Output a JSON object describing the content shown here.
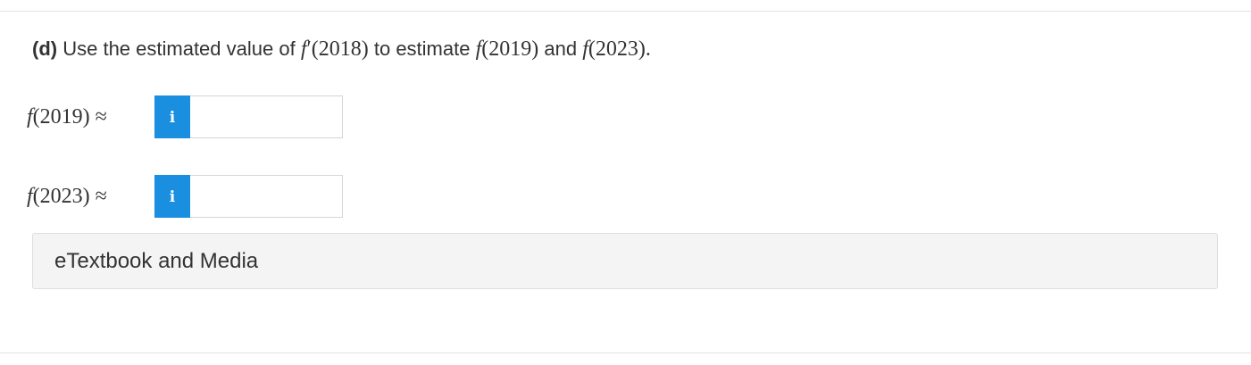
{
  "question": {
    "part_label": "(d)",
    "text_before": "Use the estimated value of",
    "derivative_expr": {
      "fn": "f",
      "prime": "′",
      "arg": "(2018)"
    },
    "text_middle": "to estimate",
    "expr1": {
      "fn": "f",
      "arg": "(2019)"
    },
    "text_and": "and",
    "expr2": {
      "fn": "f",
      "arg": "(2023)"
    },
    "end_punct": "."
  },
  "answers": [
    {
      "label_fn": "f",
      "label_arg": "(2019)",
      "approx_symbol": "≈",
      "info_icon": "i",
      "value": ""
    },
    {
      "label_fn": "f",
      "label_arg": "(2023)",
      "approx_symbol": "≈",
      "info_icon": "i",
      "value": ""
    }
  ],
  "etextbook": {
    "label": "eTextbook and Media"
  },
  "colors": {
    "info_button": "#1a8fe0",
    "panel_bg": "#f4f4f4",
    "text": "#333333"
  }
}
